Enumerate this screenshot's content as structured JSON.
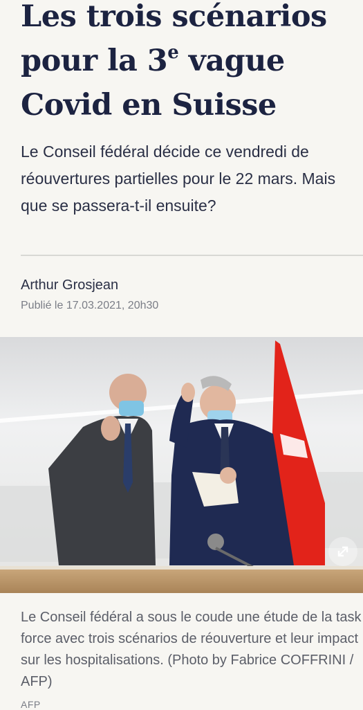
{
  "article": {
    "headline_part1": "Les trois scénarios pour la 3",
    "headline_sup": "e",
    "headline_part2": " vague Covid en Suisse",
    "lead": "Le Conseil fédéral décide ce vendredi de réouvertures partielles pour le 22 mars. Mais que se passera-t-il ensuite?",
    "author": "Arthur Grosjean",
    "published": "Publié le 17.03.2021, 20h30"
  },
  "photo": {
    "description_icon": "expand-icon",
    "caption": "Le Conseil fédéral a sous le coude une étude de la task force avec trois scénarios de réouverture et leur impact sur les hospitalisations. (Photo by Fabrice COFFRINI / AFP)",
    "credit": "AFP"
  },
  "colors": {
    "background": "#f7f6f2",
    "headline": "#1c2341",
    "flag_red": "#e2231a"
  }
}
